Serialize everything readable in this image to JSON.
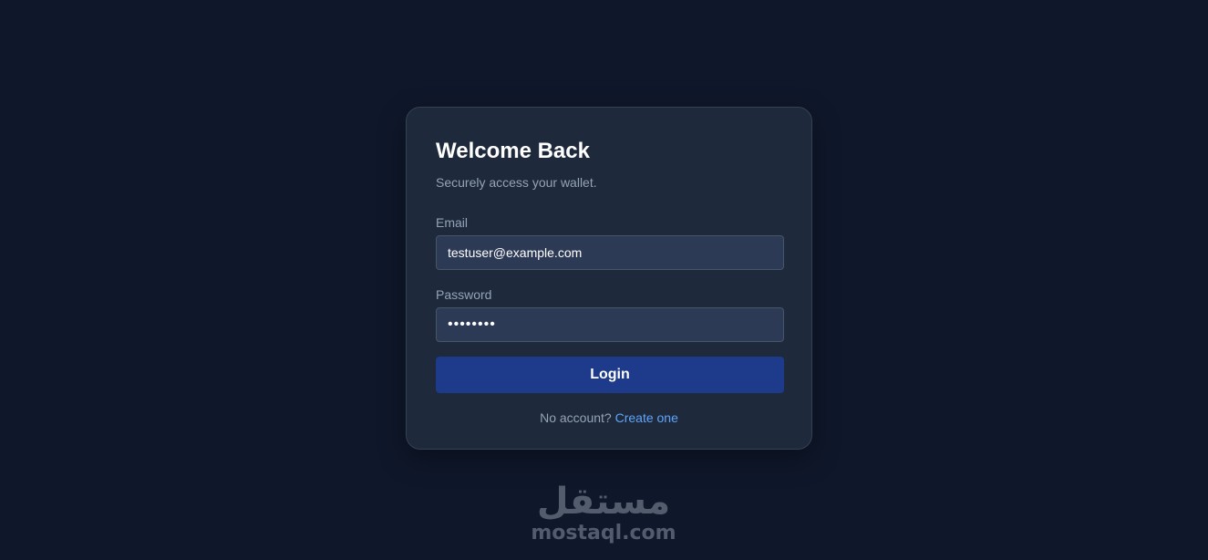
{
  "login_card": {
    "title": "Welcome Back",
    "subtitle": "Securely access your wallet.",
    "email": {
      "label": "Email",
      "value": "testuser@example.com"
    },
    "password": {
      "label": "Password",
      "value": "password"
    },
    "login_label": "Login",
    "no_account_text": "No account?",
    "create_link_label": "Create one"
  },
  "watermark": {
    "arabic_text": "مستقل",
    "latin_text": "mostaql.com"
  },
  "colors": {
    "background": "#0f172a",
    "card": "#1e293b",
    "input": "#2c3a55",
    "button": "#1e3a8a",
    "link": "#60a5fa"
  }
}
